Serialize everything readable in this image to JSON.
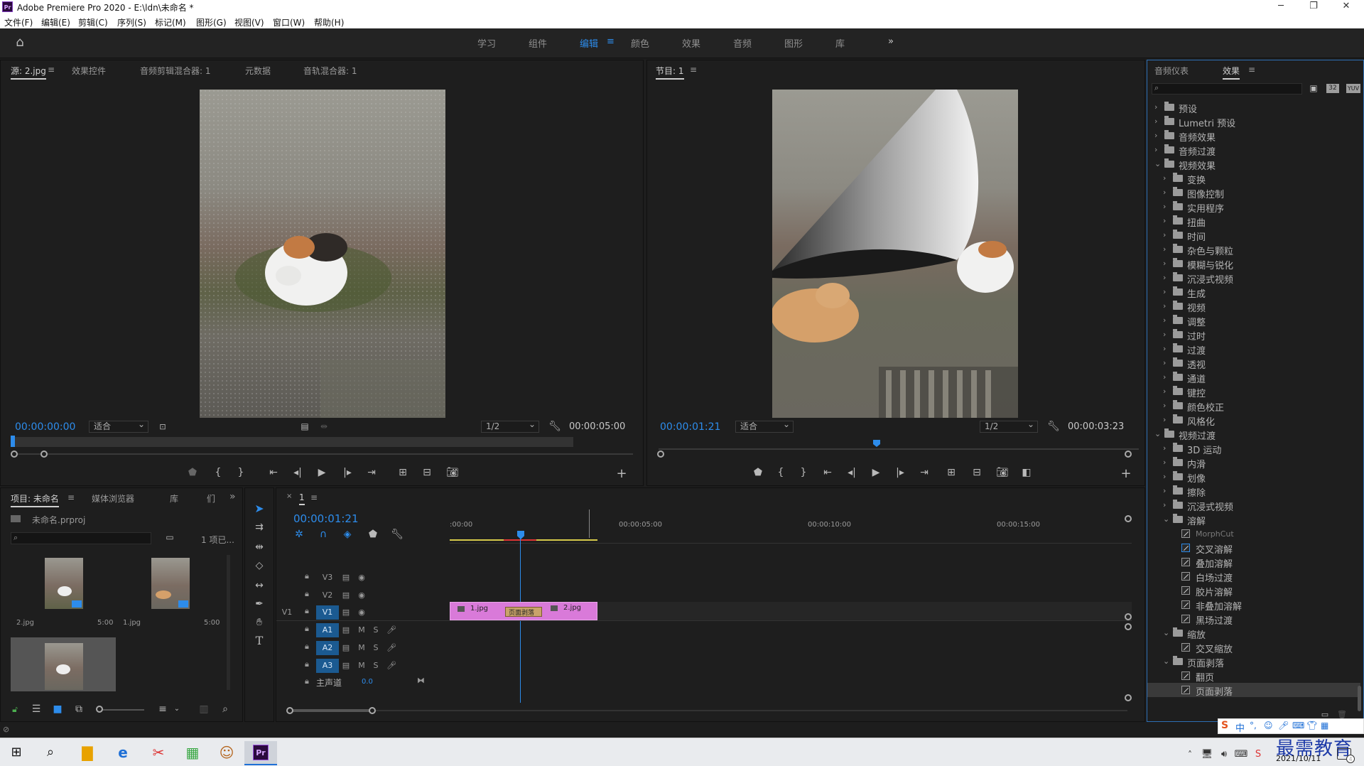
{
  "window": {
    "title": "Adobe Premiere Pro 2020 - E:\\ldn\\未命名 *",
    "app_icon": "Pr"
  },
  "menu": [
    "文件(F)",
    "编辑(E)",
    "剪辑(C)",
    "序列(S)",
    "标记(M)",
    "图形(G)",
    "视图(V)",
    "窗口(W)",
    "帮助(H)"
  ],
  "workspaces": [
    "学习",
    "组件",
    "编辑",
    "颜色",
    "效果",
    "音频",
    "图形",
    "库"
  ],
  "workspace_active": "编辑",
  "source": {
    "tabs": [
      "源: 2.jpg",
      "效果控件",
      "音频剪辑混合器: 1",
      "元数据",
      "音轨混合器: 1"
    ],
    "timecode": "00:00:00:00",
    "fit": "适合",
    "res": "1/2",
    "duration": "00:00:05:00"
  },
  "program": {
    "tab": "节目: 1",
    "timecode": "00:00:01:21",
    "fit": "适合",
    "res": "1/2",
    "duration": "00:00:03:23"
  },
  "project": {
    "tabs": [
      "项目: 未命名",
      "媒体浏览器",
      "库",
      "们"
    ],
    "file": "未命名.prproj",
    "count": "1 项已...",
    "items": [
      {
        "name": "2.jpg",
        "dur": "5:00"
      },
      {
        "name": "1.jpg",
        "dur": "5:00"
      }
    ]
  },
  "timeline": {
    "tab": "1",
    "timecode": "00:00:01:21",
    "ruler": [
      ":00:00",
      "00:00:05:00",
      "00:00:10:00",
      "00:00:15:00"
    ],
    "video_tracks": [
      "V3",
      "V2",
      "V1"
    ],
    "audio_tracks": [
      "A1",
      "A2",
      "A3"
    ],
    "source_patch": "V1",
    "track_labels": {
      "mute": "M",
      "solo": "S"
    },
    "master": "主声道",
    "master_val": "0.0",
    "clips": [
      {
        "name": "1.jpg"
      },
      {
        "name": "页面剥落"
      },
      {
        "name": "2.jpg"
      }
    ]
  },
  "effects": {
    "tabs": [
      "音频仪表",
      "效果"
    ],
    "badges": [
      "32",
      "YUV"
    ],
    "tree": [
      {
        "label": "预设",
        "level": 0,
        "kind": "folder",
        "open": false
      },
      {
        "label": "Lumetri 预设",
        "level": 0,
        "kind": "folder",
        "open": false
      },
      {
        "label": "音频效果",
        "level": 0,
        "kind": "folder",
        "open": false
      },
      {
        "label": "音频过渡",
        "level": 0,
        "kind": "folder",
        "open": false
      },
      {
        "label": "视频效果",
        "level": 0,
        "kind": "folder",
        "open": true
      },
      {
        "label": "变换",
        "level": 1,
        "kind": "folder",
        "open": false
      },
      {
        "label": "图像控制",
        "level": 1,
        "kind": "folder",
        "open": false
      },
      {
        "label": "实用程序",
        "level": 1,
        "kind": "folder",
        "open": false
      },
      {
        "label": "扭曲",
        "level": 1,
        "kind": "folder",
        "open": false
      },
      {
        "label": "时间",
        "level": 1,
        "kind": "folder",
        "open": false
      },
      {
        "label": "杂色与颗粒",
        "level": 1,
        "kind": "folder",
        "open": false
      },
      {
        "label": "模糊与锐化",
        "level": 1,
        "kind": "folder",
        "open": false
      },
      {
        "label": "沉浸式视频",
        "level": 1,
        "kind": "folder",
        "open": false
      },
      {
        "label": "生成",
        "level": 1,
        "kind": "folder",
        "open": false
      },
      {
        "label": "视频",
        "level": 1,
        "kind": "folder",
        "open": false
      },
      {
        "label": "调整",
        "level": 1,
        "kind": "folder",
        "open": false
      },
      {
        "label": "过时",
        "level": 1,
        "kind": "folder",
        "open": false
      },
      {
        "label": "过渡",
        "level": 1,
        "kind": "folder",
        "open": false
      },
      {
        "label": "透视",
        "level": 1,
        "kind": "folder",
        "open": false
      },
      {
        "label": "通道",
        "level": 1,
        "kind": "folder",
        "open": false
      },
      {
        "label": "键控",
        "level": 1,
        "kind": "folder",
        "open": false
      },
      {
        "label": "颜色校正",
        "level": 1,
        "kind": "folder",
        "open": false
      },
      {
        "label": "风格化",
        "level": 1,
        "kind": "folder",
        "open": false
      },
      {
        "label": "视频过渡",
        "level": 0,
        "kind": "folder",
        "open": true
      },
      {
        "label": "3D 运动",
        "level": 1,
        "kind": "folder",
        "open": false
      },
      {
        "label": "内滑",
        "level": 1,
        "kind": "folder",
        "open": false
      },
      {
        "label": "划像",
        "level": 1,
        "kind": "folder",
        "open": false
      },
      {
        "label": "擦除",
        "level": 1,
        "kind": "folder",
        "open": false
      },
      {
        "label": "沉浸式视频",
        "level": 1,
        "kind": "folder",
        "open": false
      },
      {
        "label": "溶解",
        "level": 1,
        "kind": "folder",
        "open": true
      },
      {
        "label": "MorphCut",
        "level": 2,
        "kind": "fx",
        "dim": true
      },
      {
        "label": "交叉溶解",
        "level": 2,
        "kind": "fx",
        "default": true
      },
      {
        "label": "叠加溶解",
        "level": 2,
        "kind": "fx"
      },
      {
        "label": "白场过渡",
        "level": 2,
        "kind": "fx"
      },
      {
        "label": "胶片溶解",
        "level": 2,
        "kind": "fx"
      },
      {
        "label": "非叠加溶解",
        "level": 2,
        "kind": "fx"
      },
      {
        "label": "黑场过渡",
        "level": 2,
        "kind": "fx"
      },
      {
        "label": "缩放",
        "level": 1,
        "kind": "folder",
        "open": true
      },
      {
        "label": "交叉缩放",
        "level": 2,
        "kind": "fx"
      },
      {
        "label": "页面剥落",
        "level": 1,
        "kind": "folder",
        "open": true
      },
      {
        "label": "翻页",
        "level": 2,
        "kind": "fx"
      },
      {
        "label": "页面剥落",
        "level": 2,
        "kind": "fx",
        "selected": true
      }
    ]
  },
  "taskbar": {
    "date": "2021/10/11",
    "ime": "中",
    "watermark": "最需教育",
    "notif": "4"
  },
  "colors": {
    "accent": "#2d8ceb",
    "clip": "#d97ad9",
    "patch": "#1b5a91"
  }
}
